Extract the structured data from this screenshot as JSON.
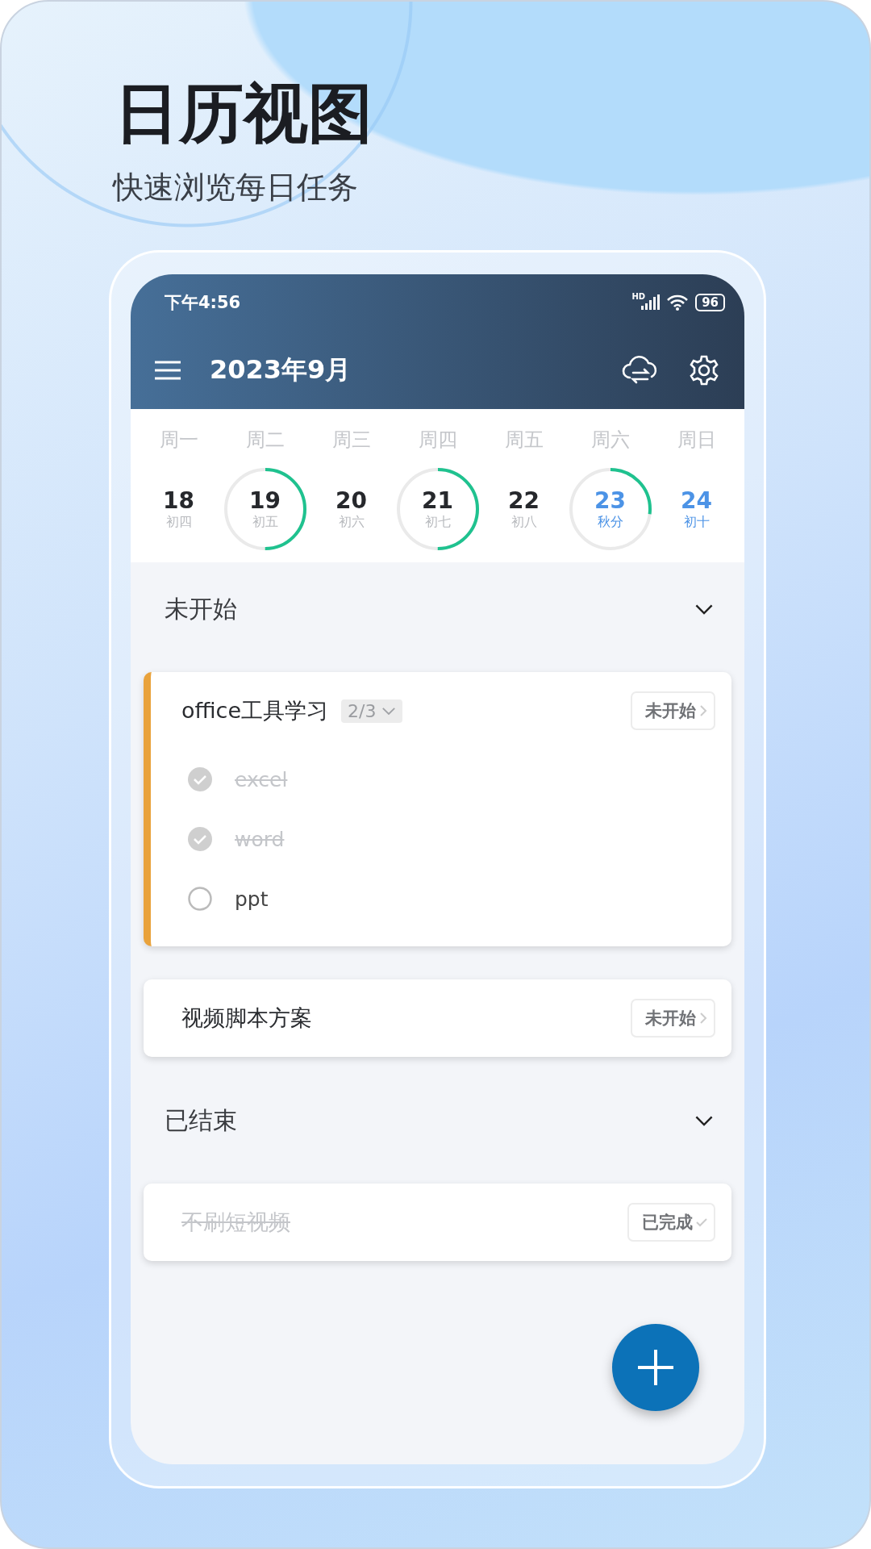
{
  "headline": "日历视图",
  "subtitle": "快速浏览每日任务",
  "status_bar": {
    "time": "下午4:56",
    "network_label": "HD",
    "battery": "96"
  },
  "header": {
    "title": "2023年9月"
  },
  "week": [
    {
      "weekday": "周一",
      "day": "18",
      "lunar": "初四",
      "weekend": false
    },
    {
      "weekday": "周二",
      "day": "19",
      "lunar": "初五",
      "weekend": false,
      "level": 0.5
    },
    {
      "weekday": "周三",
      "day": "20",
      "lunar": "初六",
      "weekend": false
    },
    {
      "weekday": "周四",
      "day": "21",
      "lunar": "初七",
      "weekend": false,
      "level": 0.5
    },
    {
      "weekday": "周五",
      "day": "22",
      "lunar": "初八",
      "weekend": false
    },
    {
      "weekday": "周六",
      "day": "23",
      "lunar": "秋分",
      "weekend": true,
      "level": 0.27
    },
    {
      "weekday": "周日",
      "day": "24",
      "lunar": "初十",
      "weekend": true
    }
  ],
  "sections": [
    {
      "title": "未开始",
      "expanded": true,
      "tasks": [
        {
          "title": "office工具学习",
          "done": false,
          "color": "#e9a23b",
          "progress": "2/3",
          "status": "未开始",
          "subtasks": [
            {
              "title": "excel",
              "checked": true
            },
            {
              "title": "word",
              "checked": true
            },
            {
              "title": "ppt",
              "checked": false
            }
          ]
        },
        {
          "title": "视频脚本方案",
          "done": false,
          "status": "未开始"
        }
      ]
    },
    {
      "title": "已结束",
      "expanded": true,
      "tasks": [
        {
          "title": "不刷短视频",
          "done": true,
          "status": "已完成"
        }
      ]
    }
  ]
}
